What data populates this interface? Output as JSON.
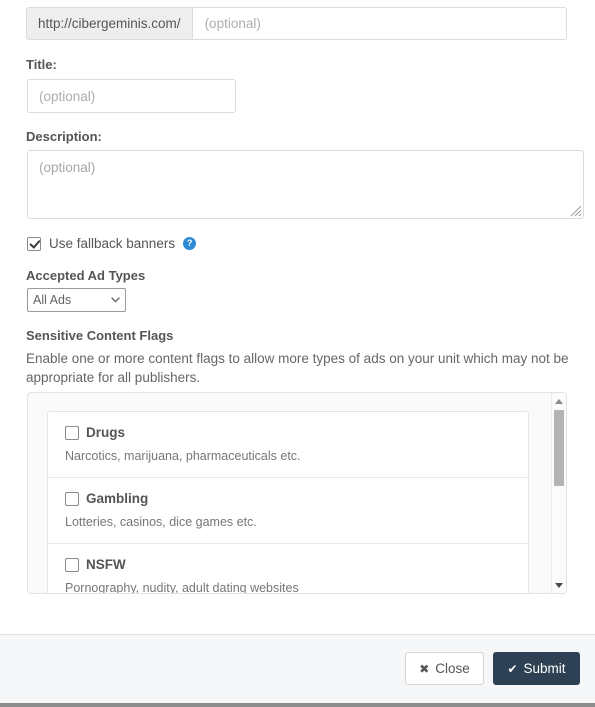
{
  "url_group": {
    "prefix": "http://cibergeminis.com/",
    "path_placeholder": "(optional)",
    "path_value": ""
  },
  "title_field": {
    "label": "Title:",
    "placeholder": "(optional)",
    "value": ""
  },
  "description_field": {
    "label": "Description:",
    "placeholder": "(optional)",
    "value": ""
  },
  "fallback": {
    "label": "Use fallback banners",
    "checked": true,
    "help_icon": "question-circle-icon"
  },
  "ad_types": {
    "label": "Accepted Ad Types",
    "selected": "All Ads",
    "options": [
      "All Ads"
    ]
  },
  "sensitive_flags": {
    "heading": "Sensitive Content Flags",
    "description": "Enable one or more content flags to allow more types of ads on your unit which may not be appropriate for all publishers.",
    "items": [
      {
        "name": "Drugs",
        "description": "Narcotics, marijuana, pharmaceuticals etc.",
        "checked": false
      },
      {
        "name": "Gambling",
        "description": "Lotteries, casinos, dice games etc.",
        "checked": false
      },
      {
        "name": "NSFW",
        "description": "Pornography, nudity, adult dating websites",
        "checked": false
      }
    ]
  },
  "footer": {
    "close_label": "Close",
    "close_icon": "x-mark-icon",
    "submit_label": "Submit",
    "submit_icon": "check-mark-icon"
  },
  "colors": {
    "submit_bg": "#2e4053",
    "help_icon": "#2e8ad4",
    "addon_bg": "#eeeeee",
    "footer_bg": "#f6f7f8"
  }
}
